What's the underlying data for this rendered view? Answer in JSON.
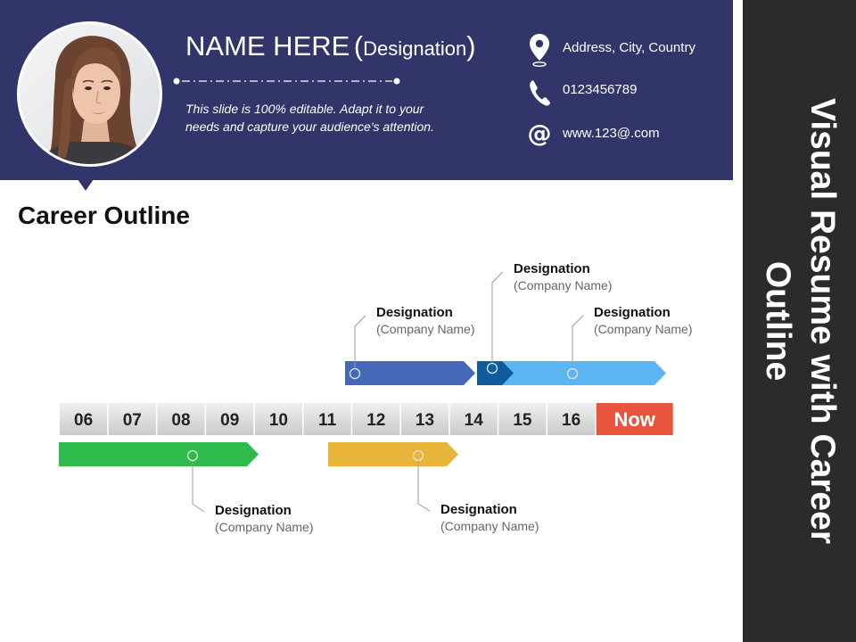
{
  "header": {
    "name": "NAME HERE",
    "paren_open": "(",
    "designation": "Designation",
    "paren_close": ")",
    "tagline": "This slide is 100% editable. Adapt it to your needs and capture your audience's attention.",
    "bg_color": "#31356a"
  },
  "contact": {
    "address": {
      "icon": "location-pin-icon",
      "text": "Address, City, Country"
    },
    "phone": {
      "icon": "phone-icon",
      "text": "0123456789"
    },
    "web": {
      "icon": "at-sign-icon",
      "text": "www.123@.com"
    }
  },
  "side_title": "Visual Resume with Career Outline",
  "section_title": "Career Outline",
  "timeline": {
    "labels": [
      "06",
      "07",
      "08",
      "09",
      "10",
      "11",
      "12",
      "13",
      "14",
      "15",
      "16"
    ],
    "now_label": "Now",
    "now_color": "#e8553e",
    "cell_color": "#d4d4d4"
  },
  "designations": [
    {
      "title": "Designation",
      "company": "(Company Name)",
      "color": "#2ebb4b",
      "from": "06",
      "to": "09"
    },
    {
      "title": "Designation",
      "company": "(Company Name)",
      "color": "#e8b43a",
      "from": "11",
      "to": "13"
    },
    {
      "title": "Designation",
      "company": "(Company Name)",
      "color": "#4668b8",
      "from": "11",
      "to": "14"
    },
    {
      "title": "Designation",
      "company": "(Company Name)",
      "color": "#0f5c9c",
      "from": "14",
      "to": "14"
    },
    {
      "title": "Designation",
      "company": "(Company Name)",
      "color": "#5bb5f2",
      "from": "14",
      "to": "16"
    }
  ]
}
